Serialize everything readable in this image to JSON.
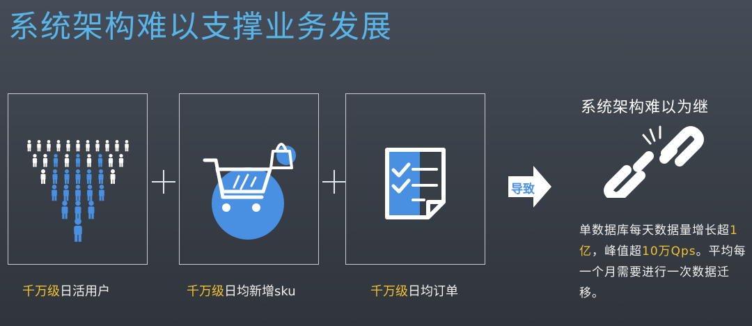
{
  "slide": {
    "title": "系统架构难以支撑业务发展"
  },
  "panels": [
    {
      "icon": "crowd-funnel-icon",
      "caption_highlight": "千万级",
      "caption_rest": "日活用户"
    },
    {
      "icon": "shopping-cart-icon",
      "caption_highlight": "千万级",
      "caption_rest": "日均新增sku"
    },
    {
      "icon": "checklist-document-icon",
      "caption_highlight": "千万级",
      "caption_rest": "日均订单"
    }
  ],
  "arrow": {
    "label": "导致",
    "icon": "right-arrow-icon"
  },
  "result": {
    "title": "系统架构难以为继",
    "icon": "broken-chain-icon",
    "desc_part1": "单数据库每天数据量增长超",
    "desc_hl1": "1亿",
    "desc_part2": "，峰值超",
    "desc_hl2": "10万Qps",
    "desc_part3": "。平均每一个月需要进行一次数据迁移。"
  },
  "colors": {
    "accent_blue": "#4a90e2",
    "title_blue": "#59b4e8",
    "highlight_yellow": "#f1c232",
    "background": "#3b4149"
  }
}
